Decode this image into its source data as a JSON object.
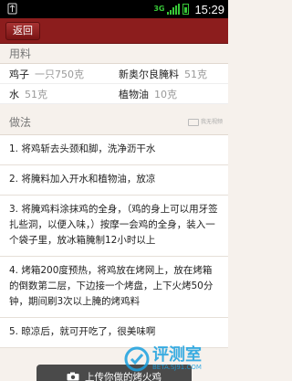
{
  "status_bar": {
    "network": "3G",
    "time": "15:29"
  },
  "title_bar": {
    "back_label": "返回"
  },
  "ingredients": {
    "header": "用料",
    "items": [
      {
        "name": "鸡子",
        "qty": "一只750克"
      },
      {
        "name": "新奥尔良腌料",
        "qty": "51克"
      },
      {
        "name": "水",
        "qty": "51克"
      },
      {
        "name": "植物油",
        "qty": "10克"
      }
    ]
  },
  "steps": {
    "header": "做法",
    "compare_label": "我无视频",
    "items": [
      "1. 将鸡斩去头颈和脚，洗净沥干水",
      "2. 将腌料加入开水和植物油，放凉",
      "3. 将腌鸡料涂抹鸡的全身，（鸡的身上可以用牙签扎些洞，以便入味，）按摩一会鸡的全身，装入一个袋子里，放冰箱腌制12小时以上",
      "4. 烤箱200度预热，将鸡放在烤网上，放在烤箱的倒数第二层，下边接一个烤盘，上下火烤50分钟，期间刷3次以上腌的烤鸡料",
      "5. 晾凉后，就可开吃了，很美味啊"
    ]
  },
  "upload": {
    "label": "上传你做的烤火鸡"
  },
  "watermark": {
    "brand": "评测室",
    "site": "BETA.SJ91.COM"
  }
}
